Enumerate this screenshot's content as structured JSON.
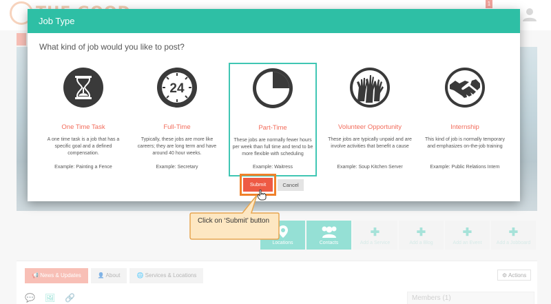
{
  "background": {
    "logo_text": "THE GOOD",
    "notification_count": "1",
    "tiles": [
      {
        "icon": "map-marker-icon",
        "label": "Locations",
        "style": "teal"
      },
      {
        "icon": "users-icon",
        "label": "Contacts",
        "style": "teal"
      },
      {
        "icon": "plus-icon",
        "label": "Add a Service",
        "style": "grey"
      },
      {
        "icon": "plus-icon",
        "label": "Add a Blog",
        "style": "grey"
      },
      {
        "icon": "plus-icon",
        "label": "Add an Event",
        "style": "grey"
      },
      {
        "icon": "plus-icon",
        "label": "Add a Jobboard",
        "style": "grey"
      }
    ],
    "panel_tabs": [
      "News & Updates",
      "About",
      "Services & Locations"
    ],
    "actions_label": "Actions",
    "members_label": "Members (1)"
  },
  "modal": {
    "title": "Job Type",
    "question": "What kind of job would you like to post?",
    "options": [
      {
        "icon": "hourglass-icon",
        "title": "One Time Task",
        "description": "A one time task is a job that has a specific goal and a defined compensation.",
        "example": "Example:  Painting a Fence",
        "selected": false
      },
      {
        "icon": "clock-24-icon",
        "title": "Full-Time",
        "description": "Typically, these jobs are more like careers; they are long term and have around 40 hour weeks.",
        "example": "Example:  Secretary",
        "selected": false
      },
      {
        "icon": "pie-clock-icon",
        "title": "Part-Time",
        "description": "These jobs are normally fewer hours per week than full time and tend to be more flexible with scheduling",
        "example": "Example:  Waitress",
        "selected": true
      },
      {
        "icon": "raised-hands-icon",
        "title": "Volunteer Opportunity",
        "description": "These jobs are typically unpaid and are involve activities that benefit a cause",
        "example": "Example:  Soup Kitchen Server",
        "selected": false
      },
      {
        "icon": "handshake-icon",
        "title": "Internship",
        "description": "This kind of job is normally temporary and emphasizes on-the-job training",
        "example": "Example:  Public Relations Intern",
        "selected": false
      }
    ],
    "submit_label": "Submit",
    "cancel_label": "Cancel"
  },
  "callout": {
    "text": "Click on ‘Submit’ button"
  },
  "colors": {
    "accent_teal": "#2ebfa5",
    "option_title": "#f26c5b",
    "submit": "#ee5a44",
    "highlight": "#f0812a",
    "callout_fill": "#fde7c2"
  }
}
